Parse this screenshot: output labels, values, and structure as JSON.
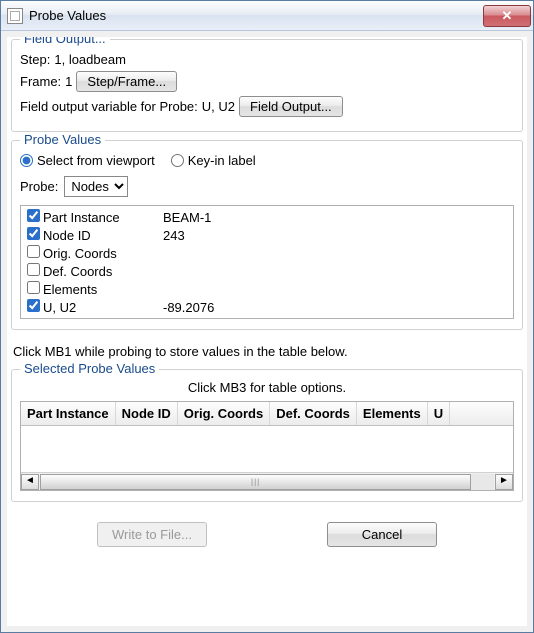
{
  "title": "Probe Values",
  "fieldOutput": {
    "legend": "Field Output...",
    "stepLabel": "Step:",
    "stepValue": "1, loadbeam",
    "frameLabel": "Frame:",
    "frameValue": "1",
    "stepFrameBtn": "Step/Frame...",
    "varLabel": "Field output variable for Probe:",
    "varValue": "U, U2",
    "fieldOutputBtn": "Field Output..."
  },
  "probeValues": {
    "legend": "Probe Values",
    "radioViewport": "Select from viewport",
    "radioKeyin": "Key-in label",
    "probeLabel": "Probe:",
    "probeSelected": "Nodes",
    "rows": [
      {
        "checked": true,
        "key": "Part Instance",
        "value": "BEAM-1"
      },
      {
        "checked": true,
        "key": "Node ID",
        "value": "243"
      },
      {
        "checked": false,
        "key": "Orig. Coords",
        "value": ""
      },
      {
        "checked": false,
        "key": "Def. Coords",
        "value": ""
      },
      {
        "checked": false,
        "key": "Elements",
        "value": ""
      },
      {
        "checked": true,
        "key": "U, U2",
        "value": "-89.2076"
      }
    ],
    "note": "Click MB1 while probing to store values in the table below."
  },
  "selected": {
    "legend": "Selected Probe Values",
    "hint": "Click MB3 for table options.",
    "columns": [
      "Part Instance",
      "Node ID",
      "Orig. Coords",
      "Def. Coords",
      "Elements",
      "U"
    ]
  },
  "footer": {
    "writeBtn": "Write to File...",
    "cancelBtn": "Cancel"
  }
}
